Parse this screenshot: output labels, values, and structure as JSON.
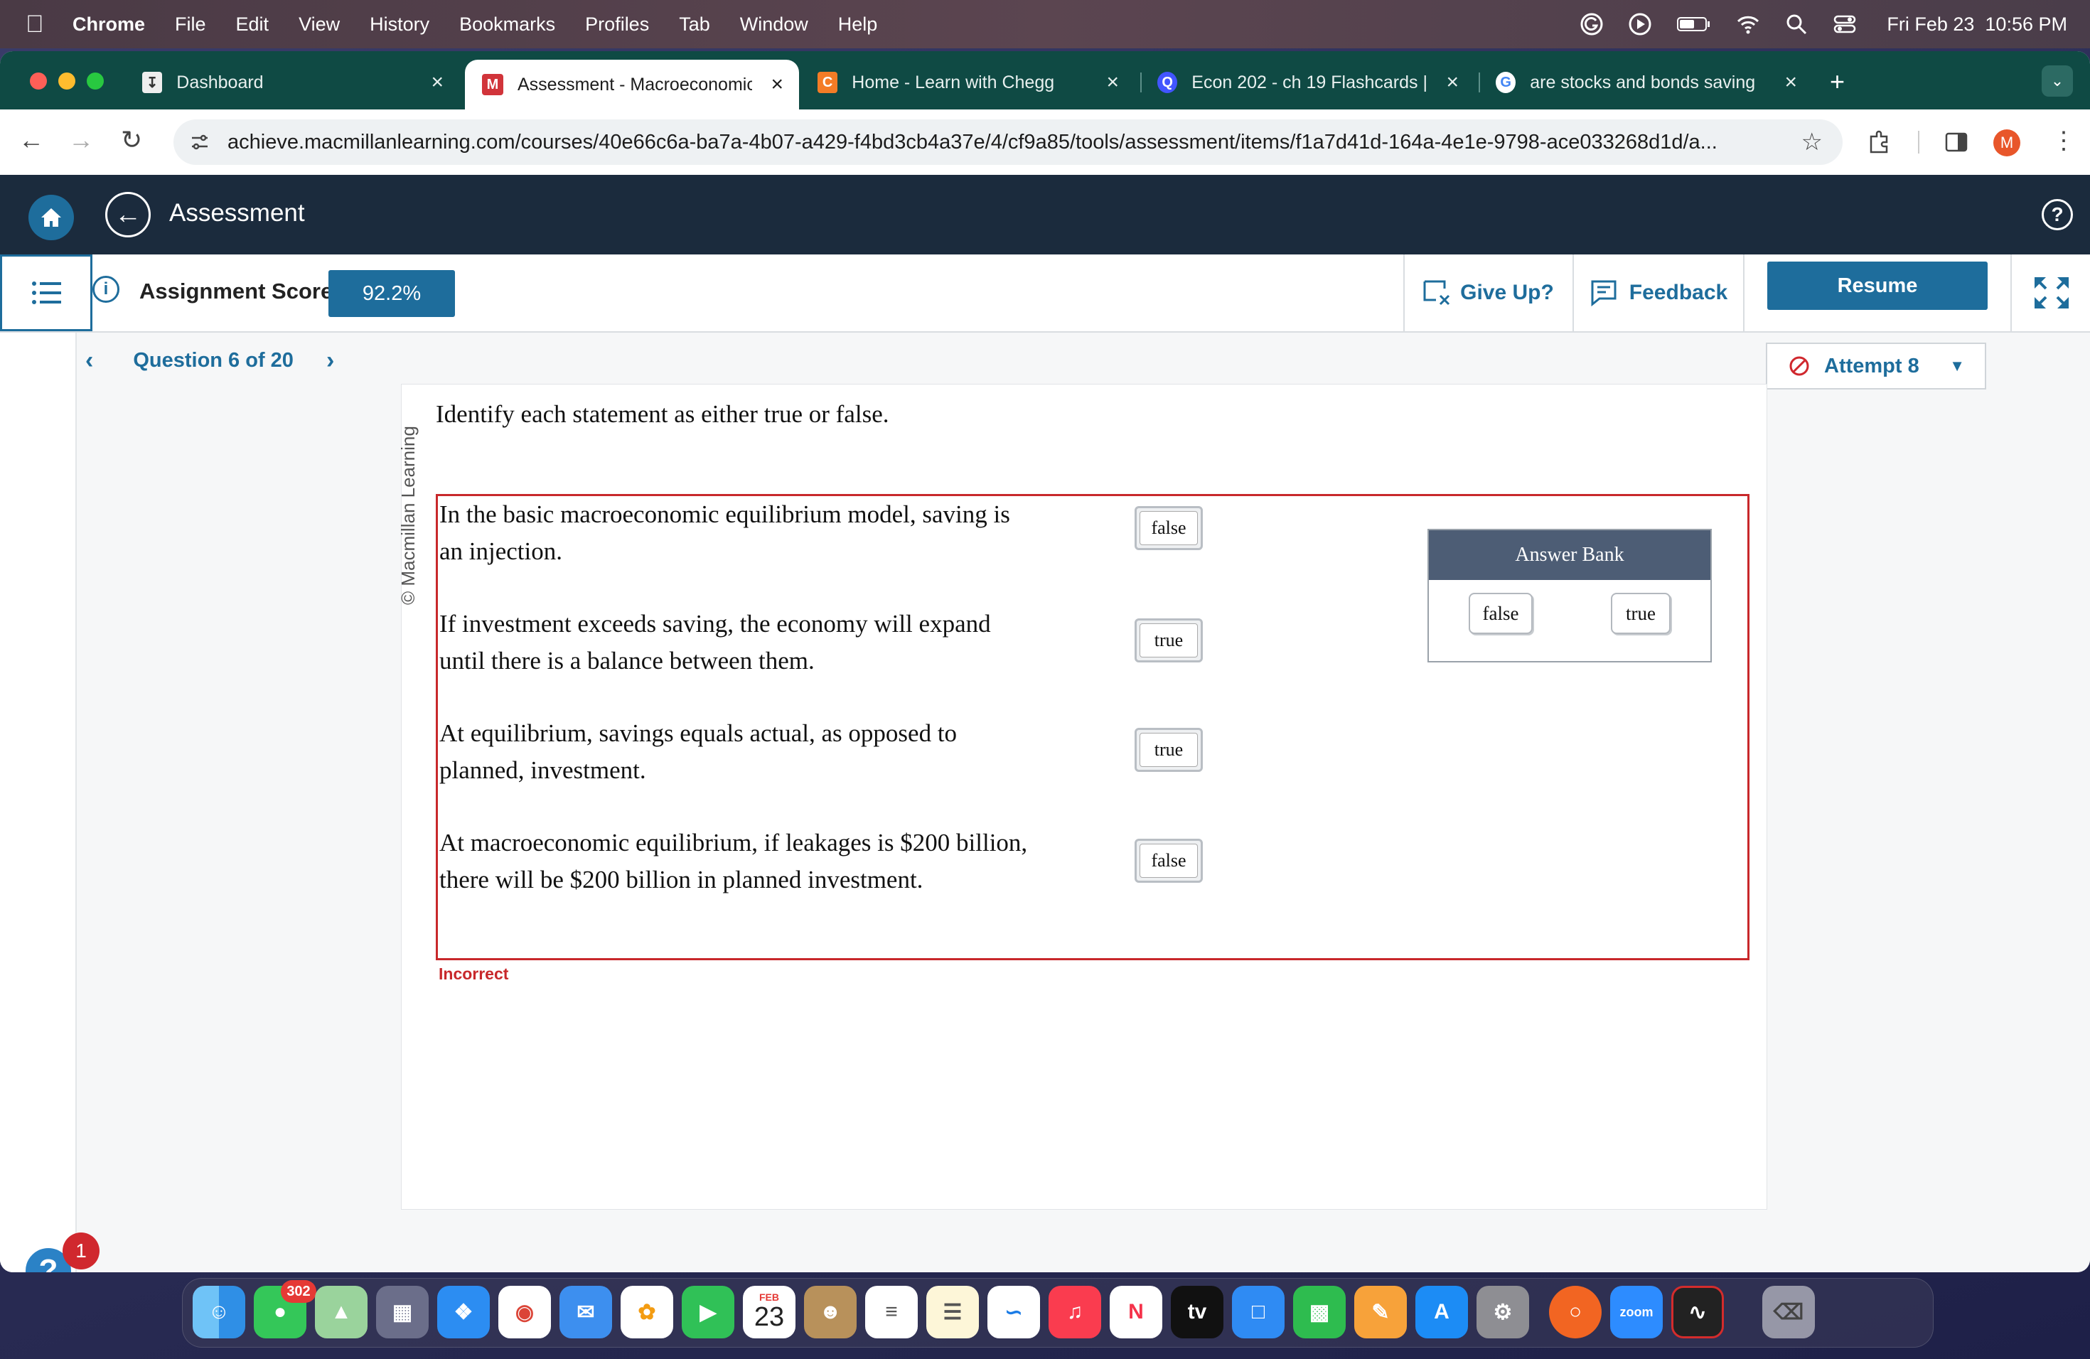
{
  "menubar": {
    "app": "Chrome",
    "items": [
      "File",
      "Edit",
      "View",
      "History",
      "Bookmarks",
      "Profiles",
      "Tab",
      "Window",
      "Help"
    ],
    "datetime": "Fri Feb 23  10:56 PM"
  },
  "tabs": [
    {
      "label": "Dashboard",
      "favicon": "dashboard-favicon"
    },
    {
      "label": "Assessment - Macroeconomic",
      "favicon": "macmillan-favicon"
    },
    {
      "label": "Home - Learn with Chegg",
      "favicon": "chegg-favicon"
    },
    {
      "label": "Econ 202 - ch 19 Flashcards |",
      "favicon": "quizlet-favicon"
    },
    {
      "label": "are stocks and bonds saving",
      "favicon": "google-favicon"
    }
  ],
  "browser": {
    "url": "achieve.macmillanlearning.com/courses/40e66c6a-ba7a-4b07-a429-f4bd3cb4a37e/4/cf9a85/tools/assessment/items/f1a7d41d-164a-4e1e-9798-ace033268d1d/a...",
    "profile_initial": "M"
  },
  "header": {
    "title": "Assessment"
  },
  "scorebar": {
    "score_label": "Assignment Score:",
    "score_value": "92.2%",
    "give_up": "Give Up?",
    "feedback": "Feedback",
    "resume": "Resume"
  },
  "question_nav": {
    "label": "Question 6 of 20"
  },
  "attempt": {
    "label": "Attempt 8"
  },
  "question": {
    "copyright": "© Macmillan Learning",
    "prompt": "Identify each statement as either true or false.",
    "statements": [
      {
        "line1": "In the basic macroeconomic equilibrium model, saving is",
        "line2": "an injection.",
        "answer": "false"
      },
      {
        "line1": "If investment exceeds saving, the economy will expand",
        "line2": "until there is a balance between them.",
        "answer": "true"
      },
      {
        "line1": "At equilibrium, savings equals actual, as opposed to",
        "line2": "planned, investment.",
        "answer": "true"
      },
      {
        "line1": "At macroeconomic equilibrium, if leakages is $200 billion,",
        "line2": "there will be $200 billion in planned investment.",
        "answer": "false"
      }
    ],
    "answer_bank": {
      "title": "Answer Bank",
      "options": [
        "false",
        "true"
      ]
    },
    "result": "Incorrect"
  },
  "help": {
    "badge": "1"
  },
  "dock": {
    "messages_badge": "302",
    "calendar_month": "FEB",
    "calendar_day": "23",
    "tv_label": "tv",
    "zoom_label": "zoom"
  },
  "colors": {
    "accent": "#1e6d9c",
    "header_bg": "#1b2b3d",
    "incorrect": "#c8282b",
    "tabstrip": "#0f4a44"
  }
}
